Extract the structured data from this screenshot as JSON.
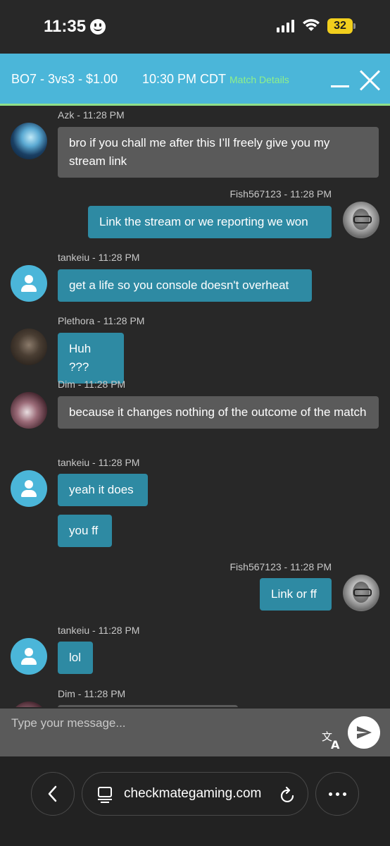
{
  "status_bar": {
    "time": "11:35",
    "battery": "32"
  },
  "header": {
    "match": "BO7 - 3vs3 - $1.00",
    "time": "10:30 PM CDT",
    "details_link": "Match Details"
  },
  "messages": [
    {
      "meta": "Azk - 11:28 PM",
      "text": "bro if you chall me after this I’ll freely give you my stream link"
    },
    {
      "meta": "Fish567123 - 11:28 PM",
      "text": "Link the stream or we reporting we won"
    },
    {
      "meta": "tankeiu - 11:28 PM",
      "text": "get a life so you console doesn't overheat"
    },
    {
      "meta": "Plethora - 11:28 PM",
      "text": "Huh ???"
    },
    {
      "meta": "Dim - 11:28 PM",
      "text": "because it changes nothing of the outcome of the match"
    },
    {
      "meta": "tankeiu - 11:28 PM",
      "text": "yeah it does"
    },
    {
      "meta": "",
      "text": "you ff"
    },
    {
      "meta": "Fish567123 - 11:28 PM",
      "text": "Link or ff"
    },
    {
      "meta": "tankeiu - 11:28 PM",
      "text": "lol"
    },
    {
      "meta": "Dim - 11:28 PM",
      "text": ""
    }
  ],
  "input": {
    "placeholder": "Type your message..."
  },
  "browser": {
    "url": "checkmategaming.com"
  },
  "colors": {
    "header": "#4bb6d9",
    "header_border": "#8fe08a",
    "blue_bubble": "#2e8aa3",
    "grey_bubble": "#5a5a5a",
    "background": "#282828",
    "battery": "#f2cf1d"
  },
  "icons": [
    "smiley-icon",
    "signal-icon",
    "wifi-icon",
    "battery-icon",
    "minimize-icon",
    "close-icon",
    "user-icon",
    "translate-icon",
    "send-icon",
    "back-icon",
    "page-icon",
    "reload-icon",
    "more-icon"
  ]
}
